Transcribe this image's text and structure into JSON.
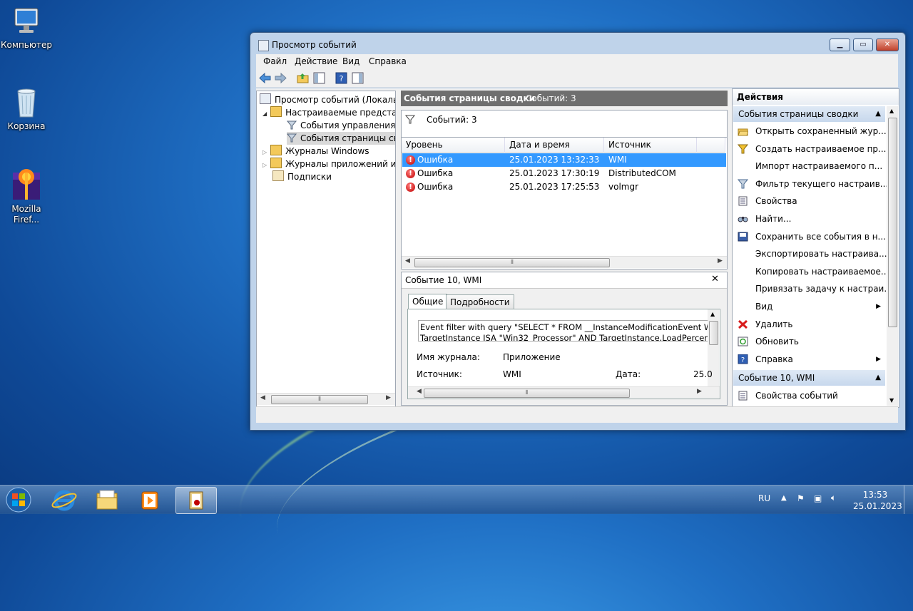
{
  "desktop": {
    "icons": [
      {
        "label": "Компьютер"
      },
      {
        "label": "Корзина"
      },
      {
        "label": "Mozilla Firef..."
      }
    ]
  },
  "window": {
    "title": "Просмотр событий",
    "controls": {
      "minimize": "▁",
      "maximize": "▭",
      "close": "✕"
    },
    "menu": [
      "Файл",
      "Действие",
      "Вид",
      "Справка"
    ],
    "tree": {
      "items": [
        {
          "label": "Просмотр событий (Локальны"
        },
        {
          "label": "Настраиваемые представле"
        },
        {
          "label": "События управления"
        },
        {
          "label": "События страницы свод"
        },
        {
          "label": "Журналы Windows"
        },
        {
          "label": "Журналы приложений и сл"
        },
        {
          "label": "Подписки"
        }
      ]
    },
    "main": {
      "header_title": "События страницы сводки",
      "header_count": "Событий: 3",
      "filter_text": "Событий: 3",
      "columns": [
        "Уровень",
        "Дата и время",
        "Источник"
      ],
      "events": [
        {
          "level": "Ошибка",
          "datetime": "25.01.2023 13:32:33",
          "source": "WMI"
        },
        {
          "level": "Ошибка",
          "datetime": "25.01.2023 17:30:19",
          "source": "DistributedCOM"
        },
        {
          "level": "Ошибка",
          "datetime": "25.01.2023 17:25:53",
          "source": "volmgr"
        }
      ],
      "selected_index": 0
    },
    "detail": {
      "title": "Событие 10, WMI",
      "close": "✕",
      "tabs": [
        "Общие",
        "Подробности"
      ],
      "description_line1": "Event filter with query \"SELECT * FROM __InstanceModificationEvent WITHIN",
      "description_line2": "TargetInstance ISA \"Win32_Processor\" AND TargetInstance.LoadPercentage",
      "log_name_label": "Имя журнала:",
      "log_name_value": "Приложение",
      "source_label": "Источник:",
      "source_value": "WMI",
      "date_label": "Дата:",
      "date_value": "25.0"
    },
    "actions": {
      "title": "Действия",
      "section1": "События страницы сводки",
      "items1": [
        {
          "label": "Открыть сохраненный жур...",
          "icon": "folder-open-icon"
        },
        {
          "label": "Создать настраиваемое пр...",
          "icon": "filter-create-icon"
        },
        {
          "label": "Импорт настраиваемого п...",
          "icon": ""
        },
        {
          "label": "Фильтр текущего настраив...",
          "icon": "filter-icon"
        },
        {
          "label": "Свойства",
          "icon": "properties-icon"
        },
        {
          "label": "Найти...",
          "icon": "find-icon"
        },
        {
          "label": "Сохранить все события в н...",
          "icon": "save-icon"
        },
        {
          "label": "Экспортировать настраива...",
          "icon": ""
        },
        {
          "label": "Копировать настраиваемое...",
          "icon": ""
        },
        {
          "label": "Привязать задачу к настраи...",
          "icon": ""
        },
        {
          "label": "Вид",
          "icon": "",
          "submenu": "▶"
        },
        {
          "label": "Удалить",
          "icon": "delete-icon"
        },
        {
          "label": "Обновить",
          "icon": "refresh-icon"
        },
        {
          "label": "Справка",
          "icon": "help-icon",
          "submenu": "▶"
        }
      ],
      "section2": "Событие 10, WMI",
      "items2": [
        {
          "label": "Свойства событий",
          "icon": "event-properties-icon"
        }
      ]
    }
  },
  "taskbar": {
    "lang": "RU",
    "time": "13:53",
    "date": "25.01.2023"
  },
  "colors": {
    "selection": "#3399ff",
    "error": "#c00000",
    "header_gray": "#6f6f6f"
  }
}
